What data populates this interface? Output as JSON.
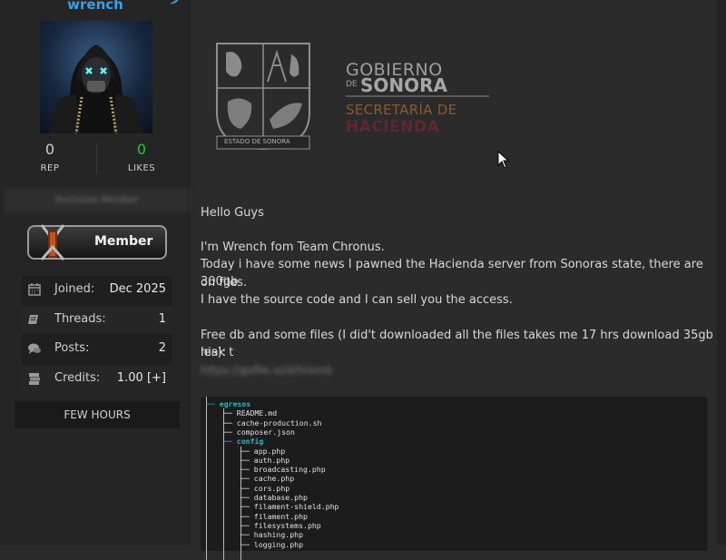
{
  "user": {
    "username": "wrench",
    "usertitle": "Exclusive Member",
    "badge_label": "Member",
    "stats": [
      {
        "value": "0",
        "label": "REP"
      },
      {
        "value": "0",
        "label": "LIKES"
      }
    ],
    "info": [
      {
        "label": "Joined:",
        "value": "Dec 2025",
        "icon": "calendar-icon"
      },
      {
        "label": "Threads:",
        "value": "1",
        "icon": "threads-icon"
      },
      {
        "label": "Posts:",
        "value": "2",
        "icon": "posts-icon"
      },
      {
        "label": "Credits:",
        "value": "1.00 [+]",
        "icon": "credits-icon"
      }
    ],
    "last_seen": "FEW HOURS"
  },
  "post": {
    "logo": {
      "line1": "GOBIERNO",
      "line2a": "DE",
      "line2b": "SONORA",
      "line3": "SECRETARÍA DE",
      "line4": "HACIENDA",
      "seal_caption": "ESTADO DE SONORA"
    },
    "greeting": "Hello Guys",
    "para1_line1": "I'm Wrench fom Team Chronus.",
    "para1_line2": "Today i have some news I pawned the Hacienda server from Sonoras state, there are 300gb",
    "para1_line3": "on files.",
    "para1_line4": "I have the source code and I can sell you the access.",
    "para2_line1": "Free db and some files (I did't downloaded all the files takes me 17 hrs download 35gb leak t",
    "para2_line2": "his):",
    "hidden_link": "https://gofile.io/d/hrxmb"
  },
  "file_tree": [
    {
      "name": "egresos",
      "type": "folder",
      "depth": 0
    },
    {
      "name": "README.md",
      "type": "file",
      "depth": 1
    },
    {
      "name": "cache-production.sh",
      "type": "file",
      "depth": 1
    },
    {
      "name": "composer.json",
      "type": "file",
      "depth": 1
    },
    {
      "name": "config",
      "type": "folder",
      "depth": 1
    },
    {
      "name": "app.php",
      "type": "file",
      "depth": 2
    },
    {
      "name": "auth.php",
      "type": "file",
      "depth": 2
    },
    {
      "name": "broadcasting.php",
      "type": "file",
      "depth": 2
    },
    {
      "name": "cache.php",
      "type": "file",
      "depth": 2
    },
    {
      "name": "cors.php",
      "type": "file",
      "depth": 2
    },
    {
      "name": "database.php",
      "type": "file",
      "depth": 2
    },
    {
      "name": "filament-shield.php",
      "type": "file",
      "depth": 2
    },
    {
      "name": "filament.php",
      "type": "file",
      "depth": 2
    },
    {
      "name": "filesystems.php",
      "type": "file",
      "depth": 2
    },
    {
      "name": "hashing.php",
      "type": "file",
      "depth": 2
    },
    {
      "name": "logging.php",
      "type": "file",
      "depth": 2
    }
  ]
}
